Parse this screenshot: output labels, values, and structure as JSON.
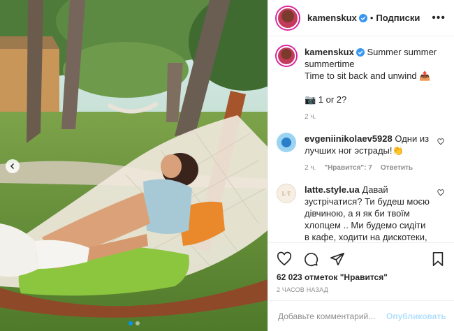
{
  "post": {
    "author": {
      "username": "kamenskux",
      "verified": true,
      "follow_label": "Подписки",
      "bullet": "•"
    },
    "caption": {
      "text": "Summer summer summertime\nTime to sit back and unwind 📤\n\n📷 1 or 2?",
      "age": "2 ч."
    },
    "comments": [
      {
        "username": "evgeniinikolaev5928",
        "text": "Одни из лучших ног эстрады!👏",
        "age": "2 ч.",
        "likes_label": "\"Нравится\": 7",
        "reply_label": "Ответить"
      },
      {
        "username": "latte.style.ua",
        "avatar_text": "L·T",
        "text": "Давай зустрічатися? Ти будеш моєю дівчиною, а я як би твоїм хлопцем .. Ми будемо сидіти в кафе, ходити на дискотеки, гуляти, можливо більше... Я буду завжди тебе"
      }
    ],
    "stats": {
      "likes": "62 023 отметок \"Нравится\"",
      "timestamp": "2 ЧАСОВ НАЗАД"
    },
    "add_comment": {
      "placeholder": "Добавьте комментарий...",
      "emoji": "☺",
      "post_label": "Опубликовать"
    },
    "carousel": {
      "slides": 2,
      "active": 1
    },
    "icons": [
      "more-icon",
      "verified-icon",
      "heart-icon",
      "comment-icon",
      "share-icon",
      "bookmark-icon",
      "chevron-left-icon"
    ],
    "colors": {
      "accent": "#0095f6",
      "post_button": "#b2dffc",
      "muted": "#8e8e8e",
      "text": "#262626"
    }
  }
}
